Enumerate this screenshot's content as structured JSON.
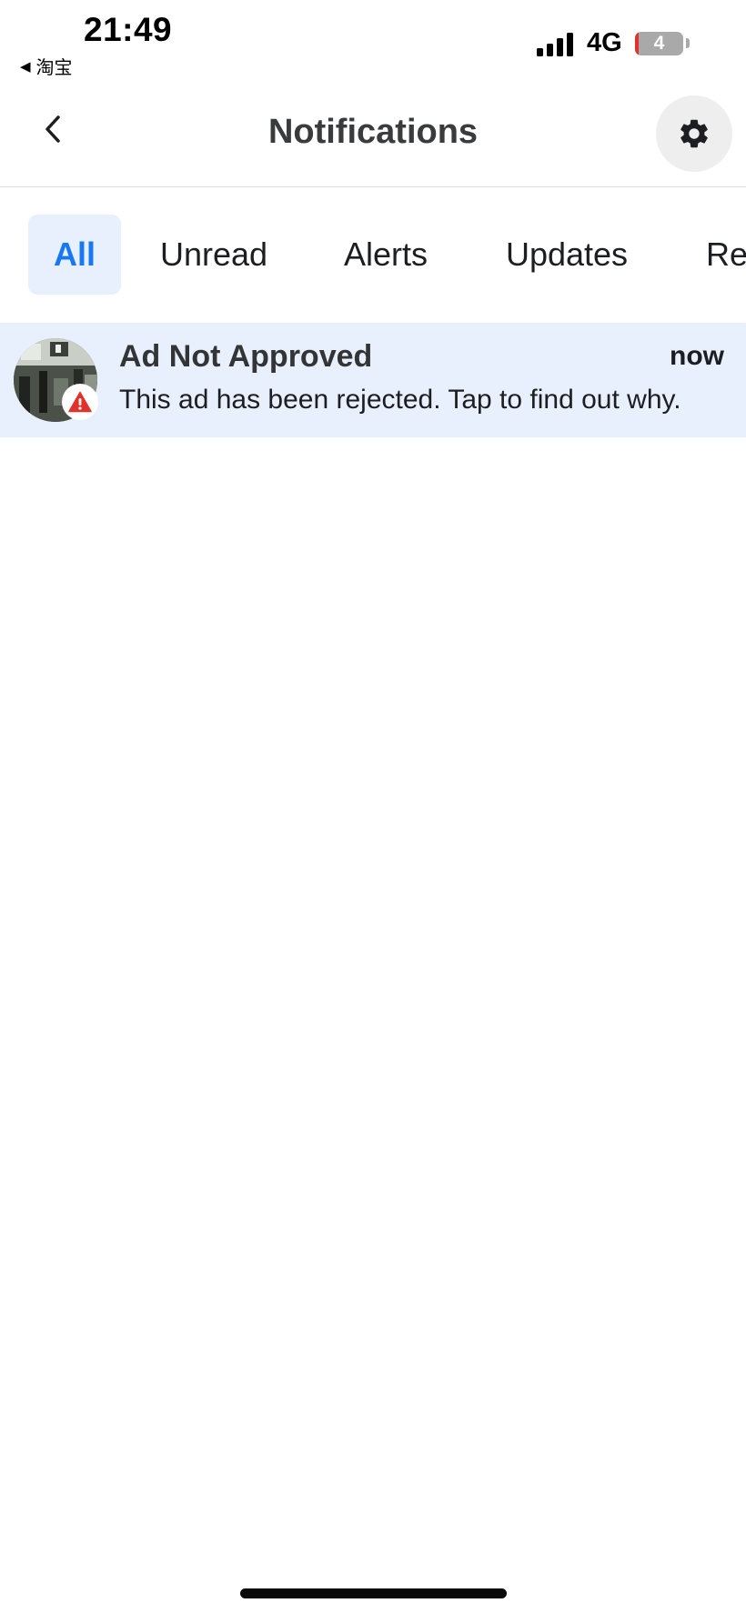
{
  "status_bar": {
    "time": "21:49",
    "back_app": "淘宝",
    "network": "4G",
    "battery": "4",
    "battery_level": 0.04
  },
  "header": {
    "title": "Notifications"
  },
  "tabs": [
    {
      "label": "All",
      "active": true
    },
    {
      "label": "Unread",
      "active": false
    },
    {
      "label": "Alerts",
      "active": false
    },
    {
      "label": "Updates",
      "active": false
    },
    {
      "label": "Re",
      "active": false
    }
  ],
  "notifications": [
    {
      "title": "Ad Not Approved",
      "time": "now",
      "body": "This ad has been rejected. Tap to find out why.",
      "badge_icon": "warning-icon"
    }
  ],
  "colors": {
    "accent": "#1877f2",
    "active_tab_bg": "#e7f0fc",
    "unread_row_bg": "#e7f0fc",
    "warning": "#e0322b"
  }
}
